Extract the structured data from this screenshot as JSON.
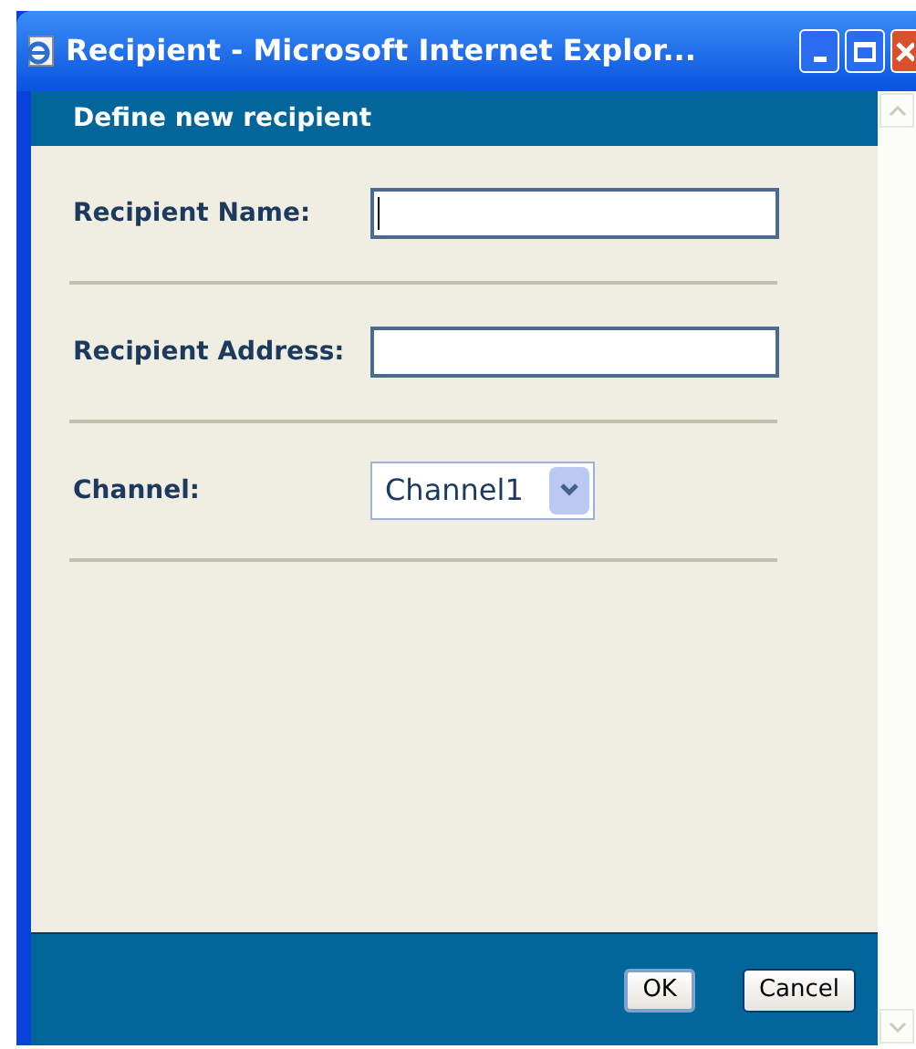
{
  "window": {
    "title": "Recipient - Microsoft Internet Explor..."
  },
  "header": "Define new recipient",
  "fields": [
    {
      "kind": "text",
      "label": "Recipient Name:",
      "focused": true
    },
    {
      "kind": "text",
      "label": "Recipient Address:",
      "focused": false
    },
    {
      "kind": "select",
      "label": "Channel:",
      "value": "Channel1"
    }
  ],
  "buttons": [
    {
      "label": "OK",
      "default": true
    },
    {
      "label": "Cancel",
      "default": false
    }
  ]
}
